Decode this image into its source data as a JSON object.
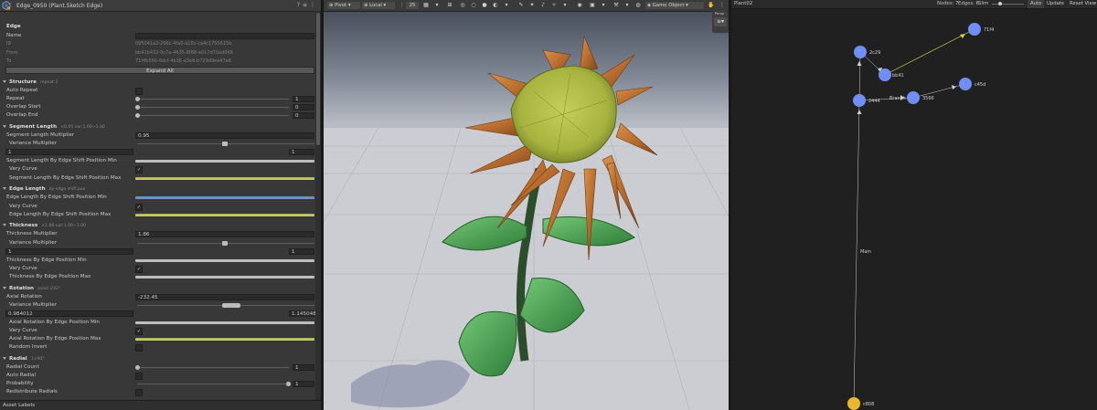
{
  "inspector": {
    "title": "Edge_0950 (Plant.Sketch Edge)",
    "header_icons": [
      "?",
      "≡",
      "⋮"
    ],
    "edge_section": "Edge",
    "name_label": "Name",
    "name_value": "",
    "id_label": "ID",
    "id_value": "095041a2-296c-4fa0-a16c-ca4c1755615b",
    "from_label": "From",
    "from_value": "bb41b432-0c7e-4635-8f88-a017d70ad048",
    "to_label": "To",
    "to_value": "71f4b566-6dcf-4b36-a3e8-b729d9ea47e8",
    "expand_all": "Expand All",
    "structure": {
      "title": "Structure",
      "summary": "repeat:1"
    },
    "auto_repeat": "Auto Repeat",
    "repeat": {
      "label": "Repeat",
      "value": "1"
    },
    "overlap_start": {
      "label": "Overlap Start",
      "value": "0"
    },
    "overlap_end": {
      "label": "Overlap End",
      "value": "0"
    },
    "segment_length": {
      "title": "Segment Length",
      "summary": "×0.95  var:1.00~1.00"
    },
    "seg_len_mult": {
      "label": "Segment Length Multiplier",
      "value": "0.95"
    },
    "seg_var_mult": {
      "label": "Variance Multiplier",
      "min": "1",
      "max": "1"
    },
    "seg_by_shift_min": "Segment Length By Edge Shift Position Min",
    "seg_vary_curve": "Vary Curve",
    "seg_by_shift_max": "Segment Length By Edge Shift Position Max",
    "edge_length": {
      "title": "Edge Length",
      "summary": "by edge shift pos"
    },
    "edge_by_shift_min": "Edge Length By Edge Shift Position Min",
    "edge_vary_curve": "Vary Curve",
    "edge_by_shift_max": "Edge Length By Edge Shift Position Max",
    "thickness": {
      "title": "Thickness",
      "summary": "×1.86  var:1.00~1.00"
    },
    "thick_mult": {
      "label": "Thickness Multiplier",
      "value": "1.86"
    },
    "thick_var_mult": {
      "label": "Variance Multiplier",
      "min": "1",
      "max": "1"
    },
    "thick_by_pos_min": "Thickness By Edge Position Min",
    "thick_vary_curve": "Vary Curve",
    "thick_by_pos_max": "Thickness By Edge Position Max",
    "rotation": {
      "title": "Rotation",
      "summary": "axial:-232°"
    },
    "axial_rotation": {
      "label": "Axial Rotation",
      "value": "-232.45"
    },
    "rot_var_mult": {
      "label": "Variance Multiplier",
      "min": "0.984012",
      "max": "1.145048"
    },
    "axial_by_pos_min": "Axial Rotation By Edge Position Min",
    "rot_vary_curve": "Vary Curve",
    "axial_by_pos_max": "Axial Rotation By Edge Position Max",
    "random_invert": "Random Invert",
    "radial": {
      "title": "Radial",
      "summary": "1×90°"
    },
    "radial_count": {
      "label": "Radial Count",
      "value": "1"
    },
    "auto_radial": "Auto Radial",
    "probability": {
      "label": "Probability",
      "value": "1"
    },
    "redistribute_radials": "Redistribute Radials",
    "asset_labels": "Asset Labels"
  },
  "scene": {
    "pivot": "Pivot",
    "local": "Local",
    "grid_size": "25",
    "game_object": "Game Object",
    "persp": "Persp"
  },
  "graph": {
    "title": "Plant02",
    "nodes_count": "Nodes: 7",
    "edges_count": "Edges: 6",
    "sim_label": "Slim",
    "auto": "Auto",
    "update": "Update",
    "reset_view": "Reset View",
    "edge_labels": {
      "main": "Main",
      "branch": "Branch"
    },
    "nodes": [
      {
        "id": "2c29",
        "color": "#6f8ff5"
      },
      {
        "id": "bb41",
        "color": "#6f8ff5"
      },
      {
        "id": "71f4",
        "color": "#6f8ff5"
      },
      {
        "id": "2444",
        "color": "#6f8ff5"
      },
      {
        "id": "3566",
        "color": "#6f8ff5"
      },
      {
        "id": "c45d",
        "color": "#6f8ff5"
      },
      {
        "id": "c808",
        "color": "#e9b82f"
      }
    ]
  },
  "colors": {
    "node_blue": "#6f8ff5",
    "node_root": "#e9b82f",
    "accent": "#3a72c4"
  }
}
